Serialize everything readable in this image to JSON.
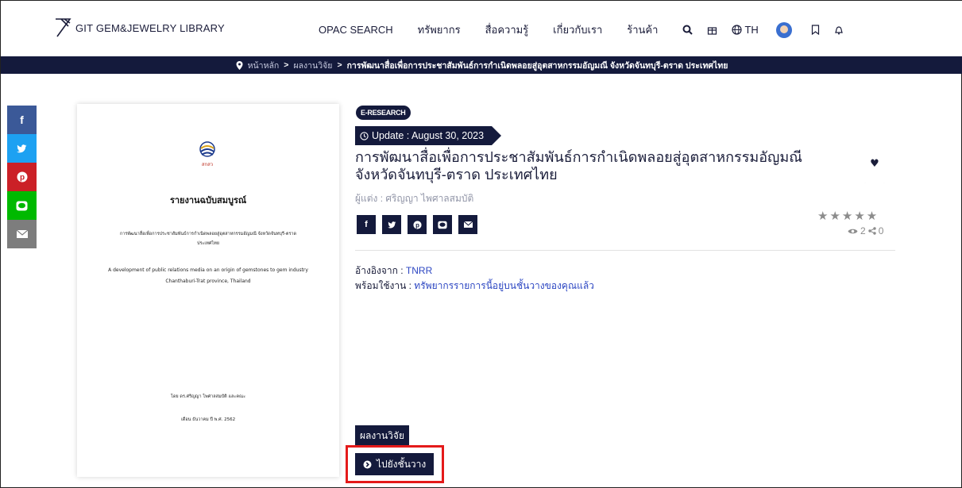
{
  "header": {
    "logo_text": "GIT GEM&JEWELRY LIBRARY",
    "nav": [
      "OPAC SEARCH",
      "ทรัพยากร",
      "สื่อความรู้",
      "เกี่ยวกับเรา",
      "ร้านค้า"
    ],
    "lang_label": "TH",
    "icons": [
      "search-icon",
      "gift-icon",
      "globe-icon",
      "avatar",
      "bookmark-icon",
      "bell-icon"
    ]
  },
  "breadcrumb": {
    "home": "หน้าหลัก",
    "section": "ผลงานวิจัย",
    "current": "การพัฒนาสื่อเพื่อการประชาสัมพันธ์การกำเนิดพลอยสู่อุตสาหกรรมอัญมณี จังหวัดจันทบุรี-ตราด ประเทศไทย",
    "separator": ">"
  },
  "social": [
    {
      "label": "f",
      "color": "#3b5998",
      "icon": "facebook-icon"
    },
    {
      "label": "🐦",
      "color": "#1da1f2",
      "icon": "twitter-icon"
    },
    {
      "label": "P",
      "color": "#cb2027",
      "icon": "pinterest-icon"
    },
    {
      "label": "L",
      "color": "#00b900",
      "icon": "line-icon"
    },
    {
      "label": "✉",
      "color": "#7d7d7d",
      "icon": "email-icon"
    }
  ],
  "cover": {
    "seal_text": "สกสว",
    "title": "รายงานฉบับสมบูรณ์",
    "th_title": "การพัฒนาสื่อเพื่อการประชาสัมพันธ์การกำเนิดพลอยสู่อุตสาหกรรมอัญมณี จังหวัดจันทบุรี-ตราด ประเทศไทย",
    "en_title": "A development of public relations media on an origin of gemstones to gem industry Chanthaburi-Trat province, Thailand",
    "by": "โดย ดร.ศริญญา ไพศาลสมบัติ และคณะ",
    "date": "เดือน ธันวาคม ปี พ.ศ. 2562"
  },
  "detail": {
    "badge": "E-RESEARCH",
    "update": "Update : August 30, 2023",
    "title": "การพัฒนาสื่อเพื่อการประชาสัมพันธ์การกำเนิดพลอยสู่อุตสาหกรรมอัญมณี จังหวัดจันทบุรี-ตราด ประเทศไทย",
    "author": "ผู้แต่ง : ศริญญา ไพศาลสมบัติ",
    "stars": "★★★★★",
    "views": "2",
    "shares": "0",
    "ref_label": "อ้างอิงจาก :",
    "ref_value": "TNRR",
    "ready_label": "พร้อมใช้งาน :",
    "ready_value": "ทรัพยากรรายการนี้อยู่บนชั้นวางของคุณแล้ว",
    "tag": "ผลงานวิจัย",
    "shelf_button": "ไปยังชั้นวาง"
  },
  "share_buttons": [
    "f",
    "🐦",
    "P",
    "L",
    "✉"
  ],
  "colors": {
    "navy": "#141a3c",
    "link": "#2c46c2",
    "highlight": "#e41a1a"
  }
}
